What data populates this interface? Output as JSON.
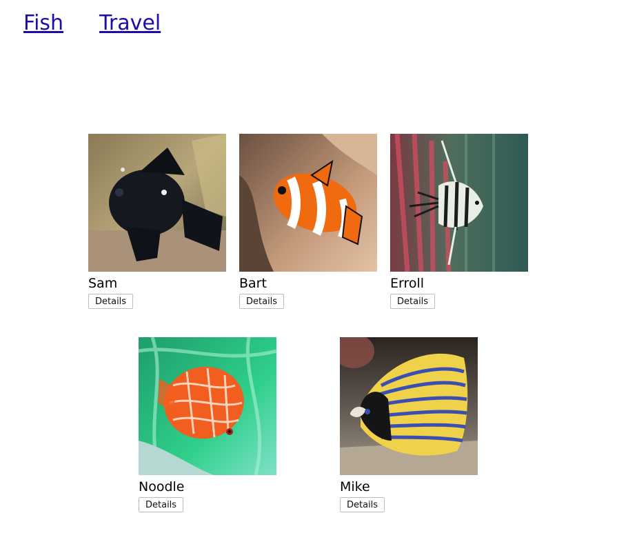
{
  "nav": {
    "fish": "Fish",
    "travel": "Travel"
  },
  "link_color": "#1a0dab",
  "fish": [
    {
      "name": "Sam",
      "button": "Details",
      "image": "black-fish-photo"
    },
    {
      "name": "Bart",
      "button": "Details",
      "image": "clownfish-photo"
    },
    {
      "name": "Erroll",
      "button": "Details",
      "image": "angelfish-photo"
    },
    {
      "name": "Noodle",
      "button": "Details",
      "image": "discus-fish-photo"
    },
    {
      "name": "Mike",
      "button": "Details",
      "image": "emperor-angelfish-photo"
    }
  ]
}
